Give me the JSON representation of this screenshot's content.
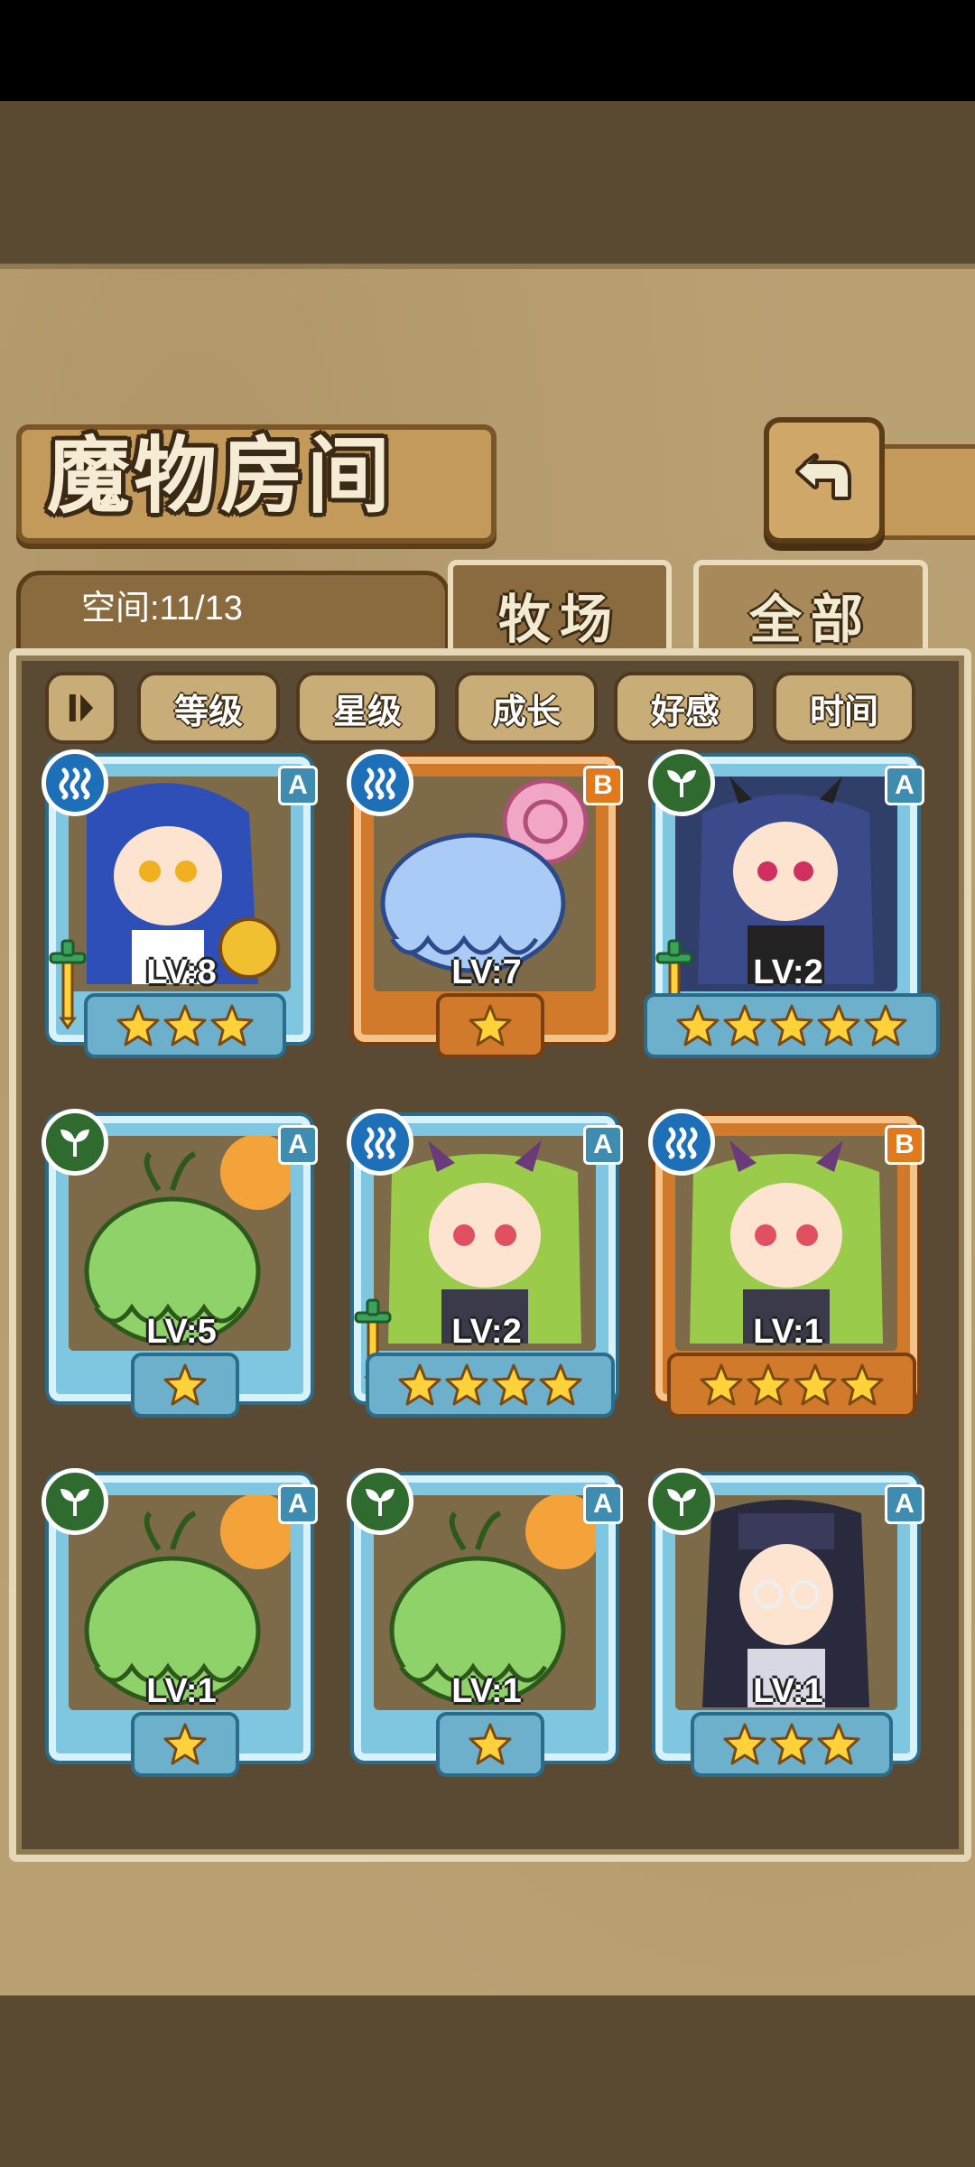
{
  "header": {
    "title": "魔物房间",
    "back_icon": "back-arrow-icon"
  },
  "tabs": {
    "space_label": "空间:11/13",
    "ranch": "牧场",
    "all": "全部"
  },
  "sort": {
    "toggle_icon": "sort-toggle-icon",
    "buttons": [
      "等级",
      "星级",
      "成长",
      "好感",
      "时间"
    ]
  },
  "monsters": [
    {
      "element": "water",
      "rank": "A",
      "level": "LV:8",
      "stars": 3,
      "weapon": true,
      "art": "blue-haired-girl"
    },
    {
      "element": "water",
      "rank": "B",
      "level": "LV:7",
      "stars": 1,
      "weapon": false,
      "art": "blue-slime-snail"
    },
    {
      "element": "nature",
      "rank": "A",
      "level": "LV:2",
      "stars": 5,
      "weapon": true,
      "art": "dark-horned-girl"
    },
    {
      "element": "nature",
      "rank": "A",
      "level": "LV:5",
      "stars": 1,
      "weapon": false,
      "art": "green-slime"
    },
    {
      "element": "water",
      "rank": "A",
      "level": "LV:2",
      "stars": 4,
      "weapon": true,
      "art": "green-horned-girl"
    },
    {
      "element": "water",
      "rank": "B",
      "level": "LV:1",
      "stars": 4,
      "weapon": false,
      "art": "green-horned-girl"
    },
    {
      "element": "nature",
      "rank": "A",
      "level": "LV:1",
      "stars": 1,
      "weapon": false,
      "art": "green-slime"
    },
    {
      "element": "nature",
      "rank": "A",
      "level": "LV:1",
      "stars": 1,
      "weapon": false,
      "art": "green-slime"
    },
    {
      "element": "nature",
      "rank": "A",
      "level": "LV:1",
      "stars": 3,
      "weapon": false,
      "art": "dark-haired-glasses-girl"
    }
  ]
}
